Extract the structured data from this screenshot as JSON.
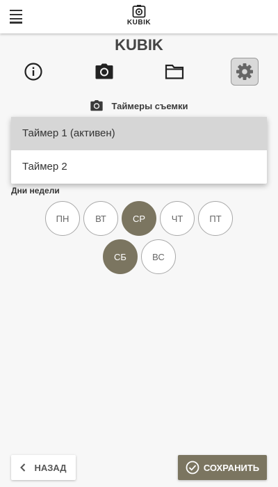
{
  "header": {
    "logo_text": "KUBIK",
    "menu_icon": "hamburger-menu-icon"
  },
  "app_title": "KUBIK",
  "nav": {
    "items": [
      {
        "icon": "info-icon"
      },
      {
        "icon": "camera-icon"
      },
      {
        "icon": "folder-icon"
      },
      {
        "icon": "settings-gear-icon",
        "active": true
      }
    ]
  },
  "section": {
    "icon": "camera-icon",
    "title": "Таймеры съемки"
  },
  "timer_select": {
    "options": [
      {
        "label": "Таймер 1 (активен)",
        "selected": true
      },
      {
        "label": "Таймер 2",
        "selected": false
      }
    ]
  },
  "days": {
    "label": "Дни недели",
    "items": [
      {
        "label": "ПН",
        "on": false
      },
      {
        "label": "ВТ",
        "on": false
      },
      {
        "label": "СР",
        "on": true
      },
      {
        "label": "ЧТ",
        "on": false
      },
      {
        "label": "ПТ",
        "on": false
      },
      {
        "label": "СБ",
        "on": true
      },
      {
        "label": "ВС",
        "on": false
      }
    ]
  },
  "actions": {
    "back_label": "Назад",
    "save_label": "Сохранить"
  },
  "colors": {
    "accent": "#7b7560",
    "background": "#f7f7f7",
    "selected_option": "#d6d6d6"
  }
}
